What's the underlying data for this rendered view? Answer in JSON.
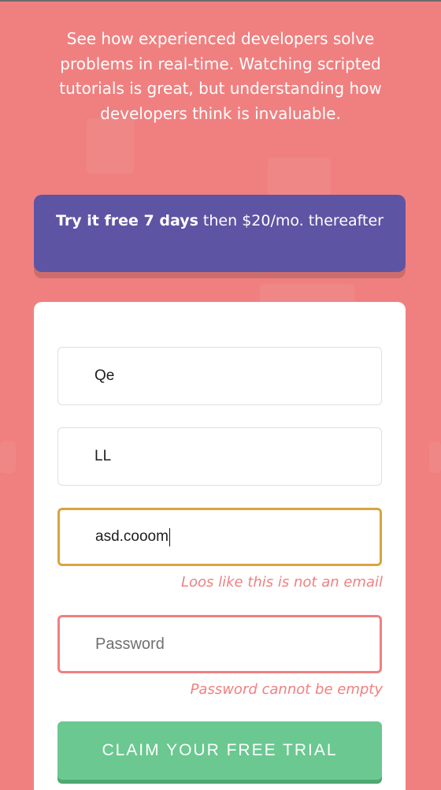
{
  "intro": {
    "text": "See how experienced developers solve problems in real-time. Watching scripted tutorials is great, but understanding how developers think is invaluable."
  },
  "offer": {
    "bold": "Try it free 7 days",
    "rest": " then $20/mo. thereafter"
  },
  "form": {
    "first_name": {
      "value": "Qe"
    },
    "last_name": {
      "value": "LL"
    },
    "email": {
      "value": "asd.cooom",
      "error": "Loos like this is not an email"
    },
    "password": {
      "placeholder": "Password",
      "error": "Password cannot be empty"
    },
    "submit_label": "CLAIM YOUR FREE TRIAL"
  },
  "colors": {
    "background": "#f08080",
    "offer_bg": "#5e54a4",
    "cta_bg": "#6ac890",
    "error": "#f08080",
    "focus_border": "#d9a43f"
  }
}
